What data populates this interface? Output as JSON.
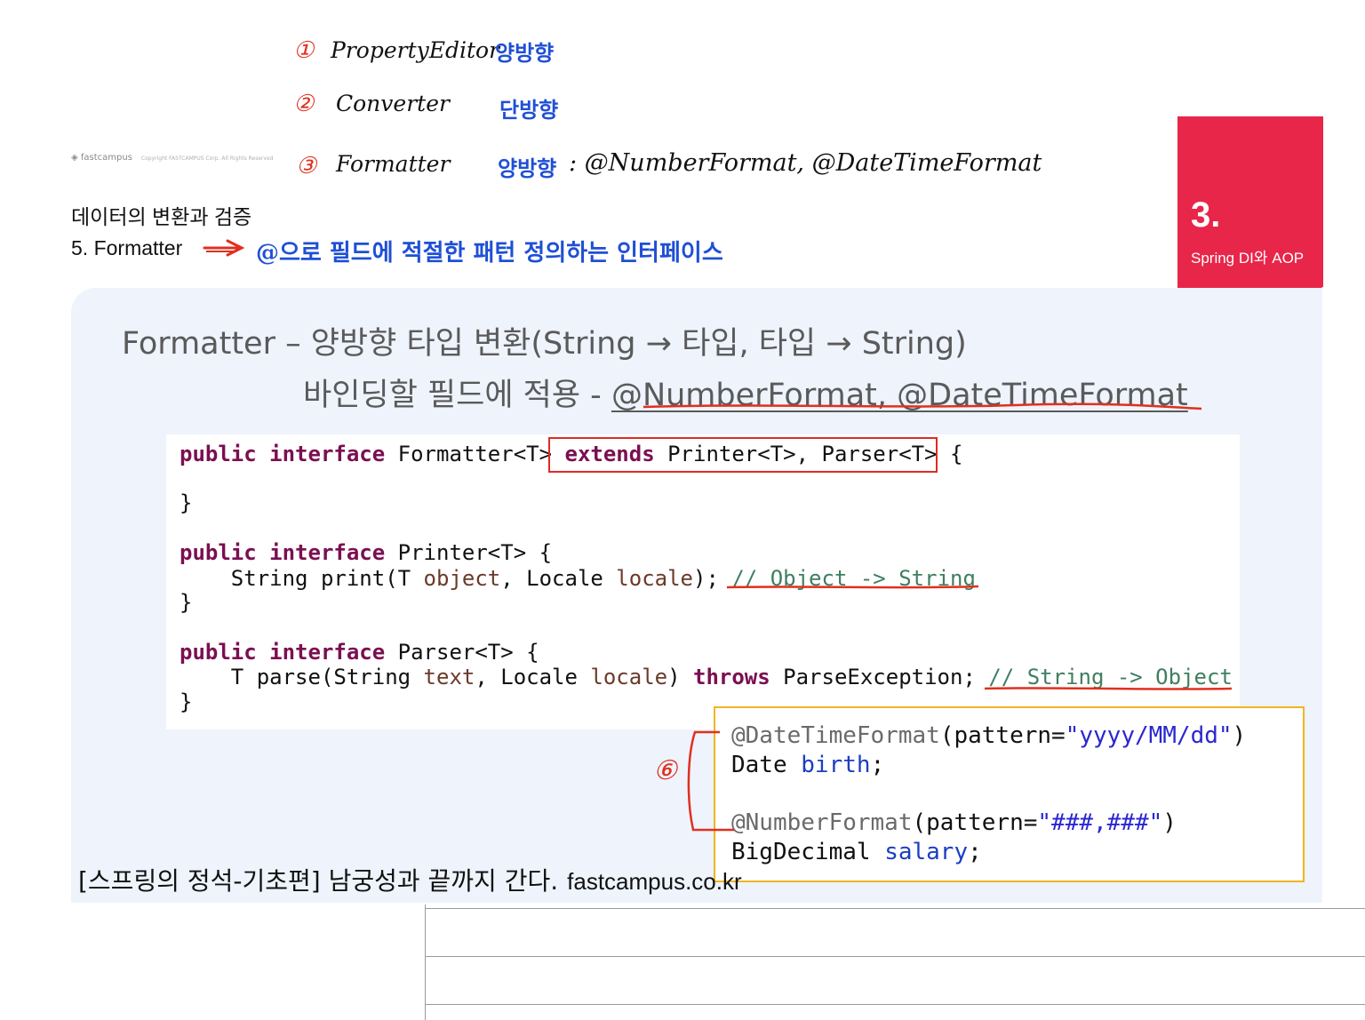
{
  "notes": {
    "item1": {
      "num": "①",
      "name": "PropertyEditor",
      "dir": "양방향"
    },
    "item2": {
      "num": "②",
      "name": "Converter",
      "dir": "단방향"
    },
    "item3": {
      "num": "③",
      "name": "Formatter",
      "dir": "양방향",
      "extra": ": @NumberFormat, @DateTimeFormat"
    },
    "line5": "@으로 필드에 적절한 패턴 정의하는 인터페이스",
    "badge": "⑥"
  },
  "logo": {
    "brand": "fastcampus",
    "copyright": "Copyright FASTCAMPUS Corp. All Rights Reserved"
  },
  "section": {
    "title": "데이터의 변환과 검증",
    "subsection": "5. Formatter"
  },
  "chapter": {
    "number": "3.",
    "label": "Spring DI와 AOP"
  },
  "slide": {
    "title_line1": "Formatter – 양방향 타입 변환(String → 타입, 타입 → String)",
    "title_line2_prefix": "바인딩할 필드에 적용 - ",
    "title_line2_annotations": "@NumberFormat, @DateTimeFormat"
  },
  "code": {
    "l1_kw1": "public",
    "l1_kw2": "interface",
    "l1_rest": " Formatter<T> ",
    "l1_kw3": "extends",
    "l1_tail": " Printer<T>, Parser<T> {",
    "l2": "}",
    "l3_kw1": "public",
    "l3_kw2": "interface",
    "l3_rest": " Printer<T> {",
    "l4_a": "    String print(T ",
    "l4_v1": "object",
    "l4_b": ", Locale ",
    "l4_v2": "locale",
    "l4_c": "); ",
    "l4_cmt": "// Object -> String",
    "l5": "}",
    "l6_kw1": "public",
    "l6_kw2": "interface",
    "l6_rest": " Parser<T> {",
    "l7_a": "    T parse(String ",
    "l7_v1": "text",
    "l7_b": ", Locale ",
    "l7_v2": "locale",
    "l7_c": ") ",
    "l7_kw": "throws",
    "l7_d": " ParseException; ",
    "l7_cmt": "// String -> Object",
    "l8": "}"
  },
  "example": {
    "a1": "@DateTimeFormat",
    "a1_open": "(pattern=",
    "a1_str": "\"yyyy/MM/dd\"",
    "a1_close": ")",
    "f1_type": "Date ",
    "f1_name": "birth",
    "f1_semi": ";",
    "a2": "@NumberFormat",
    "a2_open": "(pattern=",
    "a2_str": "\"###,###\"",
    "a2_close": ")",
    "f2_type": "BigDecimal ",
    "f2_name": "salary",
    "f2_semi": ";"
  },
  "footer": {
    "course": "[스프링의 정석-기초편] 남궁성과 끝까지 간다.",
    "site": "fastcampus.co.kr"
  }
}
